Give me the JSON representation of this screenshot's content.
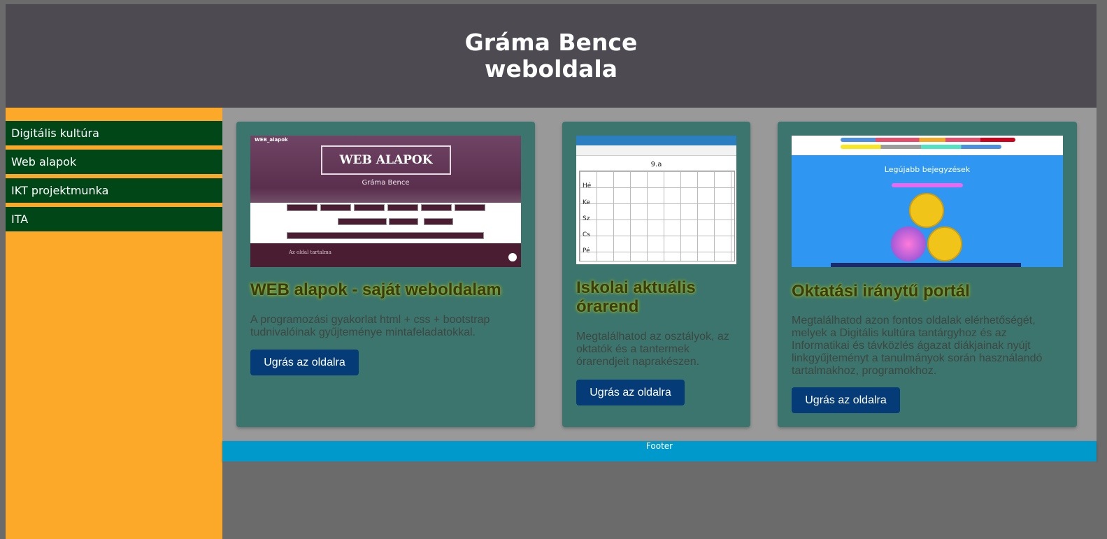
{
  "header": {
    "title_line1": "Gráma Bence",
    "title_line2": "weboldala"
  },
  "sidebar": {
    "items": [
      {
        "label": "Digitális kultúra"
      },
      {
        "label": "Web alapok"
      },
      {
        "label": "IKT projektmunka"
      },
      {
        "label": "ITA"
      }
    ]
  },
  "cards": [
    {
      "title": "WEB alapok - saját weboldalam",
      "description": "A programozási gyakorlat html + css + bootstrap tudnivalóinak gyűjteménye mintafeladatokkal.",
      "button": "Ugrás az oldalra",
      "thumb": {
        "tag": "WEB_alapok",
        "heading": "WEB ALAPOK",
        "sub": "Gráma Bence",
        "footer_text": "Az oldal tartalma"
      }
    },
    {
      "title": "Iskolai aktuális órarend",
      "description": "Megtalálhatod az osztályok, az oktatók és a tantermek órarendjeit naprakészen.",
      "button": "Ugrás az oldalra",
      "thumb": {
        "class": "9.a",
        "days": [
          "Hé",
          "Ke",
          "Sz",
          "Cs",
          "Pé"
        ]
      }
    },
    {
      "title": "Oktatási iránytű portál",
      "description": "Megtalálhatod azon fontos oldalak elérhetőségét, melyek a Digitális kultúra tantárgyhoz és az Informatikai és távközlés ágazat diákjainak nyújt linkgyűjteményt a tanulmányok során használandó tartalmakhoz, programokhoz.",
      "button": "Ugrás az oldalra",
      "thumb": {
        "heading": "Legújabb bejegyzések"
      }
    }
  ],
  "footer": {
    "text": "Footer"
  },
  "colors": {
    "header_bg": "#4d4a52",
    "sidebar_bg": "#fca92a",
    "nav_item_bg": "#004616",
    "content_bg": "#999999",
    "card_bg": "#3b756d",
    "button_bg": "#053b76",
    "footer_bg": "#0099cc"
  }
}
